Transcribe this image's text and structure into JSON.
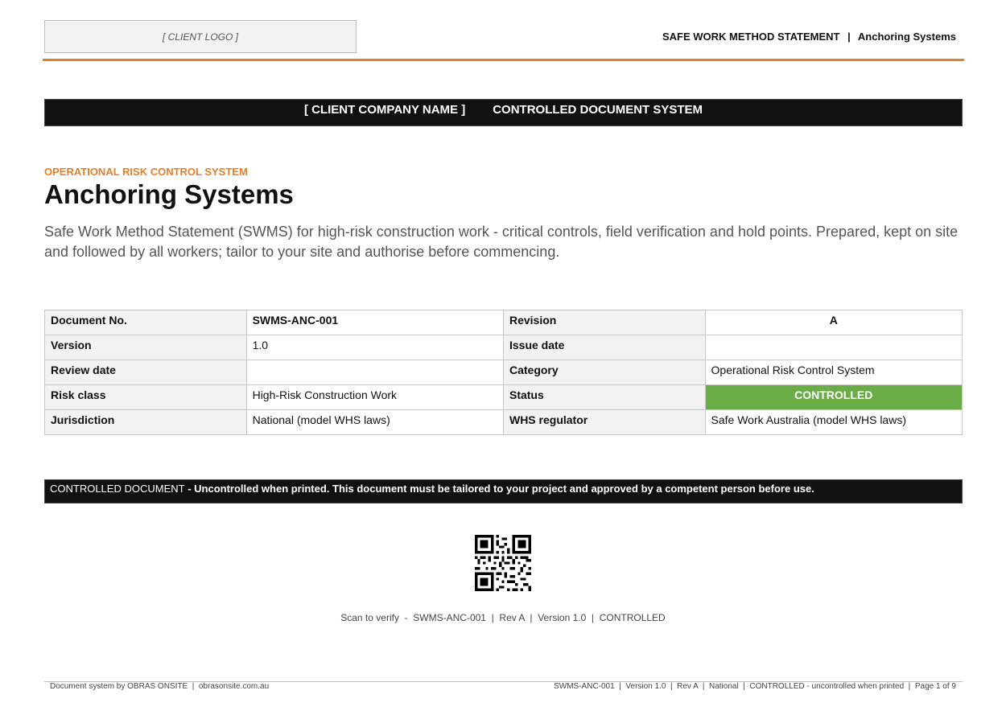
{
  "header": {
    "logo_placeholder": "[ CLIENT LOGO ]",
    "doc_type": "SAFE WORK METHOD STATEMENT",
    "separator": "|",
    "doc_topic": "Anchoring Systems"
  },
  "banner": {
    "company": "[ CLIENT COMPANY NAME ]",
    "system": "CONTROLLED DOCUMENT SYSTEM"
  },
  "intro": {
    "eyebrow": "OPERATIONAL RISK CONTROL SYSTEM",
    "title": "Anchoring Systems",
    "description": "Safe Work Method Statement (SWMS) for high-risk construction work - critical controls, field verification and hold points. Prepared, kept on site and followed by all workers; tailor to your site and authorise before commencing."
  },
  "meta": [
    {
      "k1": "Document No.",
      "v1": "SWMS-ANC-001",
      "k2": "Revision",
      "v2": "A"
    },
    {
      "k1": "Version",
      "v1": "1.0",
      "k2": "Issue date",
      "v2": ""
    },
    {
      "k1": "Review date",
      "v1": "",
      "k2": "Category",
      "v2": "Operational Risk Control System"
    },
    {
      "k1": "Risk class",
      "v1": "High-Risk Construction Work",
      "k2": "Status",
      "v2": "CONTROLLED"
    },
    {
      "k1": "Jurisdiction",
      "v1": "National (model WHS laws)",
      "k2": "WHS regulator",
      "v2": "Safe Work Australia (model WHS laws)"
    }
  ],
  "notice": {
    "lead": "CONTROLLED DOCUMENT",
    "text": " - Uncontrolled when printed. This document must be tailored to your project and approved by a competent person before use."
  },
  "verify": {
    "text": "Scan to verify  -  SWMS-ANC-001  |  Rev A  |  Version 1.0  |  CONTROLLED"
  },
  "footer": {
    "left": "Document system by OBRAS ONSITE  |  obrasonsite.com.au",
    "right": "SWMS-ANC-001  |  Version 1.0  |  Rev A  |  National  |  CONTROLLED - uncontrolled when printed  |  Page 1 of 9"
  },
  "colors": {
    "accent": "#e07f2c",
    "status_green": "#6aac46",
    "banner_black": "#111111"
  }
}
